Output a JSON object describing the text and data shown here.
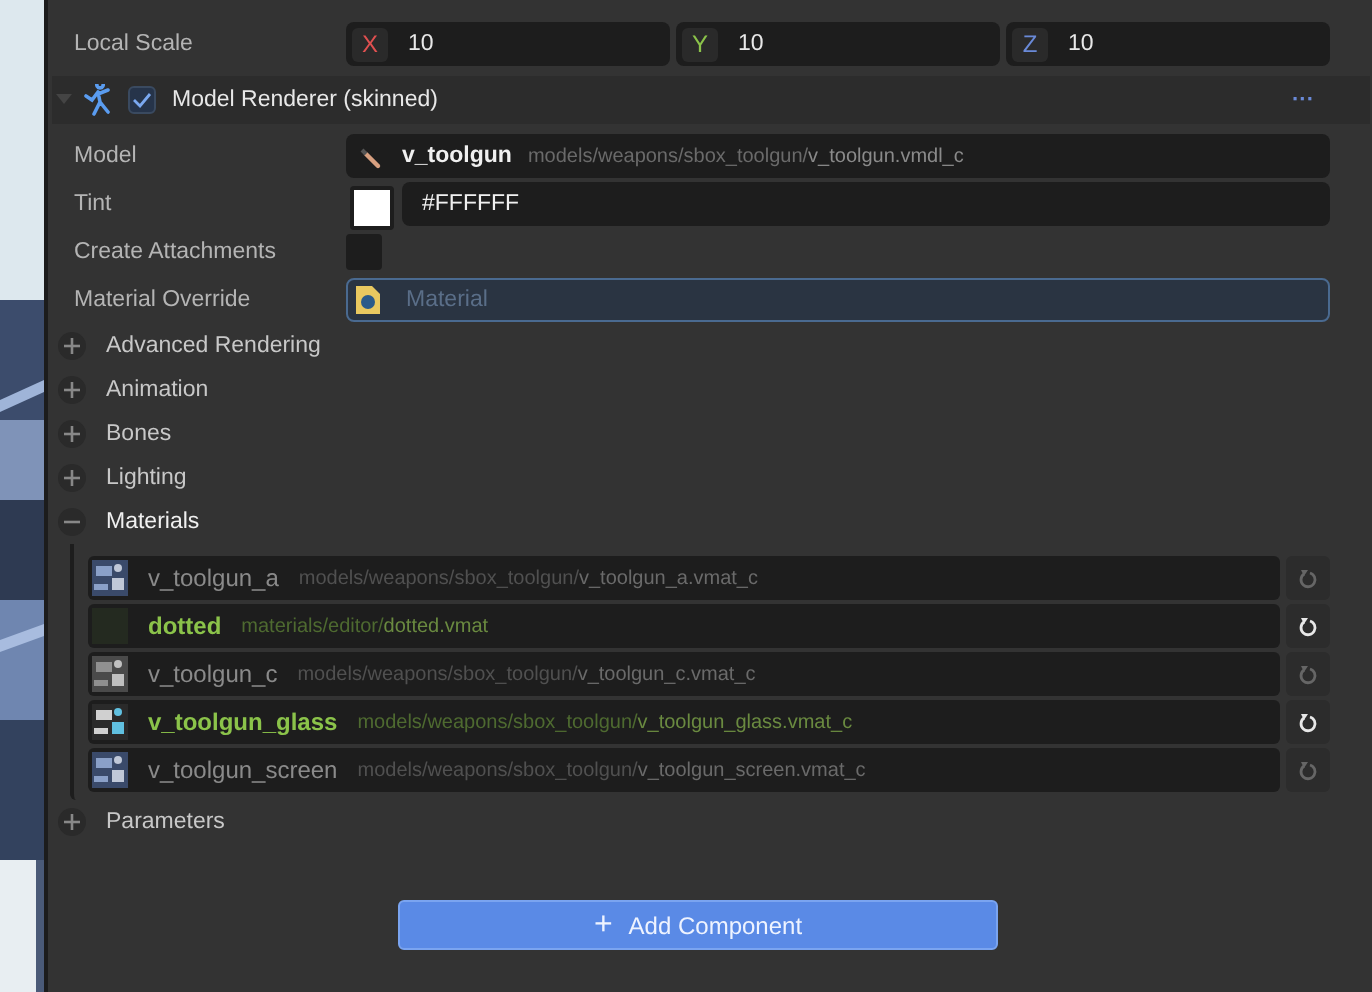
{
  "transform": [
    {
      "label": "Local Scale",
      "kind": "scale",
      "axes": [
        {
          "axis": "X",
          "value": "10"
        },
        {
          "axis": "Y",
          "value": "10"
        },
        {
          "axis": "Z",
          "value": "10"
        }
      ]
    }
  ],
  "component": {
    "title": "Model Renderer (skinned)",
    "enabled": true,
    "menu": "···"
  },
  "properties": [
    {
      "label": "Model",
      "kind": "asset",
      "name": "v_toolgun",
      "dir": "models/weapons/sbox_toolgun/",
      "file": "v_toolgun.vmdl_c"
    },
    {
      "label": "Tint",
      "kind": "color",
      "color": "#ffffff",
      "value": "#FFFFFF"
    },
    {
      "label": "Create Attachments",
      "kind": "checkbox",
      "checked": false
    },
    {
      "label": "Material Override",
      "kind": "picker",
      "placeholder": "Material"
    }
  ],
  "sections": [
    {
      "label": "Advanced Rendering",
      "expanded": false
    },
    {
      "label": "Animation",
      "expanded": false
    },
    {
      "label": "Bones",
      "expanded": false
    },
    {
      "label": "Lighting",
      "expanded": false
    },
    {
      "label": "Materials",
      "expanded": true,
      "children": [
        {
          "name": "v_toolgun_a",
          "dir": "models/weapons/sbox_toolgun/",
          "file": "v_toolgun_a.vmat_c",
          "overridden": false,
          "kind": "picture"
        },
        {
          "name": "dotted",
          "dir": "materials/editor/",
          "file": "dotted.vmat",
          "overridden": true
        },
        {
          "name": "v_toolgun_c",
          "dir": "models/weapons/sbox_toolgun/",
          "file": "v_toolgun_c.vmat_c",
          "overridden": false,
          "kind": "picture"
        },
        {
          "name": "v_toolgun_glass",
          "dir": "models/weapons/sbox_toolgun/",
          "file": "v_toolgun_glass.vmat_c",
          "overridden": true,
          "kind": "picture"
        },
        {
          "name": "v_toolgun_screen",
          "dir": "models/weapons/sbox_toolgun/",
          "file": "v_toolgun_screen.vmat_c",
          "overridden": false,
          "kind": "picture"
        }
      ]
    },
    {
      "label": "Parameters",
      "expanded": false
    }
  ],
  "add_button": {
    "icon": "+",
    "label": "Add Component"
  }
}
